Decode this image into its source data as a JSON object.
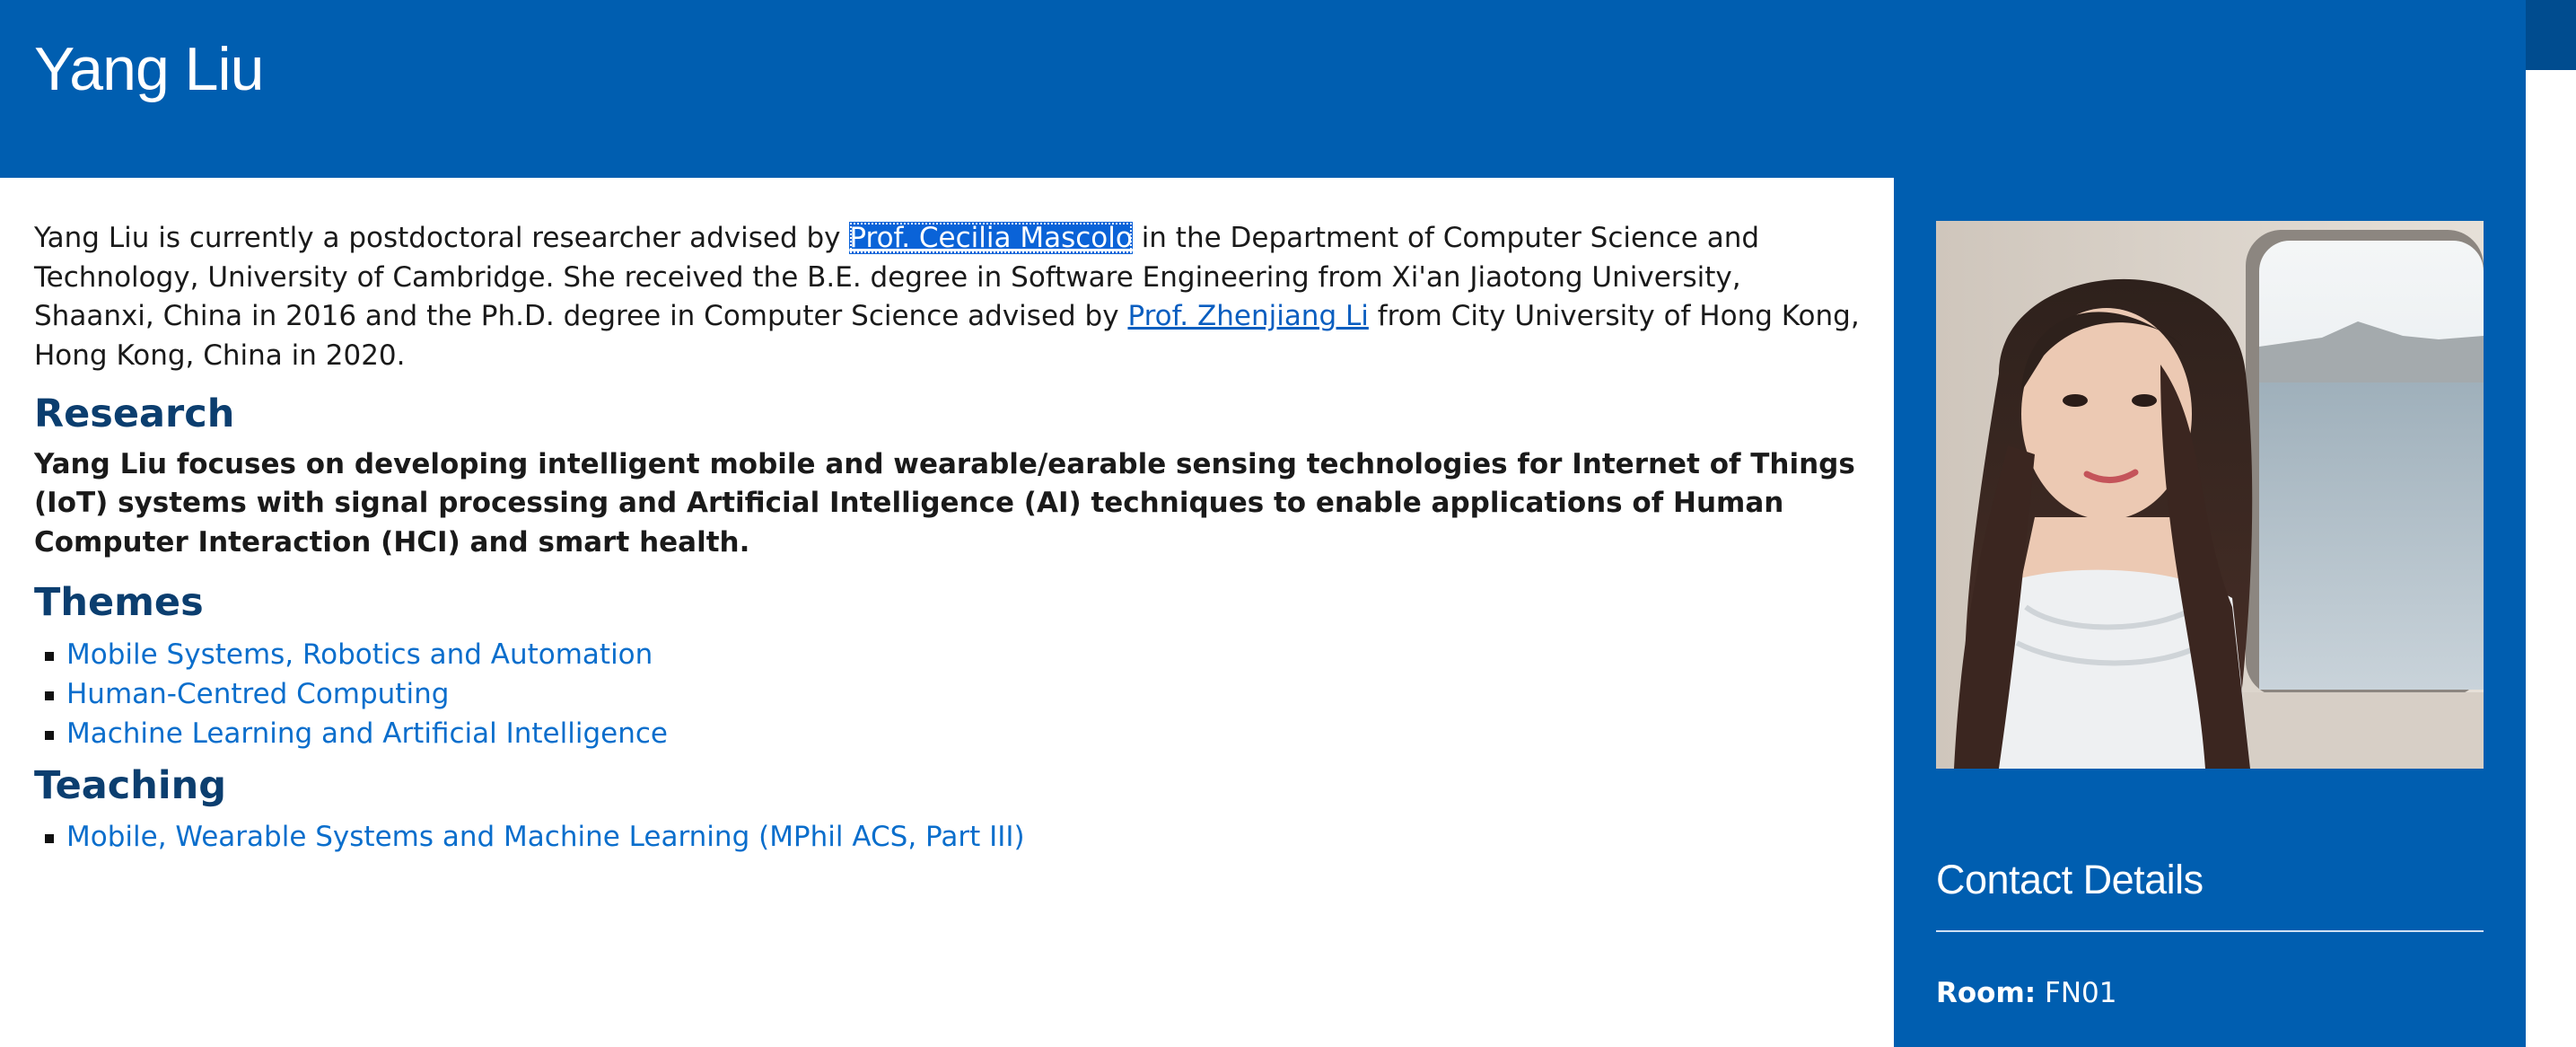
{
  "header": {
    "title": "Yang Liu"
  },
  "intro": {
    "part1": "Yang Liu is currently a postdoctoral researcher advised by ",
    "advisor1": "Prof. Cecilia Mascolo",
    "part2": " in the Department of Computer Science and Technology, University of Cambridge. She received the B.E. degree in Software Engineering from Xi'an Jiaotong University, Shaanxi, China in 2016 and the Ph.D. degree in Computer Science advised by ",
    "advisor2": "Prof. Zhenjiang Li",
    "part3": " from City University of Hong Kong, Hong Kong, China in 2020."
  },
  "research": {
    "heading": "Research",
    "text": "Yang Liu focuses on developing intelligent mobile and wearable/earable sensing technologies for Internet of Things (IoT) systems with signal processing and Artificial Intelligence (AI) techniques to enable applications of Human Computer Interaction (HCI) and smart health."
  },
  "themes": {
    "heading": "Themes",
    "items": [
      "Mobile Systems, Robotics and Automation",
      "Human-Centred Computing",
      "Machine Learning and Artificial Intelligence"
    ]
  },
  "teaching": {
    "heading": "Teaching",
    "items": [
      "Mobile, Wearable Systems and Machine Learning (MPhil ACS, Part III)"
    ]
  },
  "sidebar": {
    "photo_icon": "profile-photo",
    "contact_heading": "Contact Details",
    "room_label": "Room:",
    "room_value": "FN01"
  },
  "colors": {
    "brand_blue": "#005eb0",
    "heading_blue": "#0b3e6f",
    "link_blue": "#0a6ecc"
  }
}
